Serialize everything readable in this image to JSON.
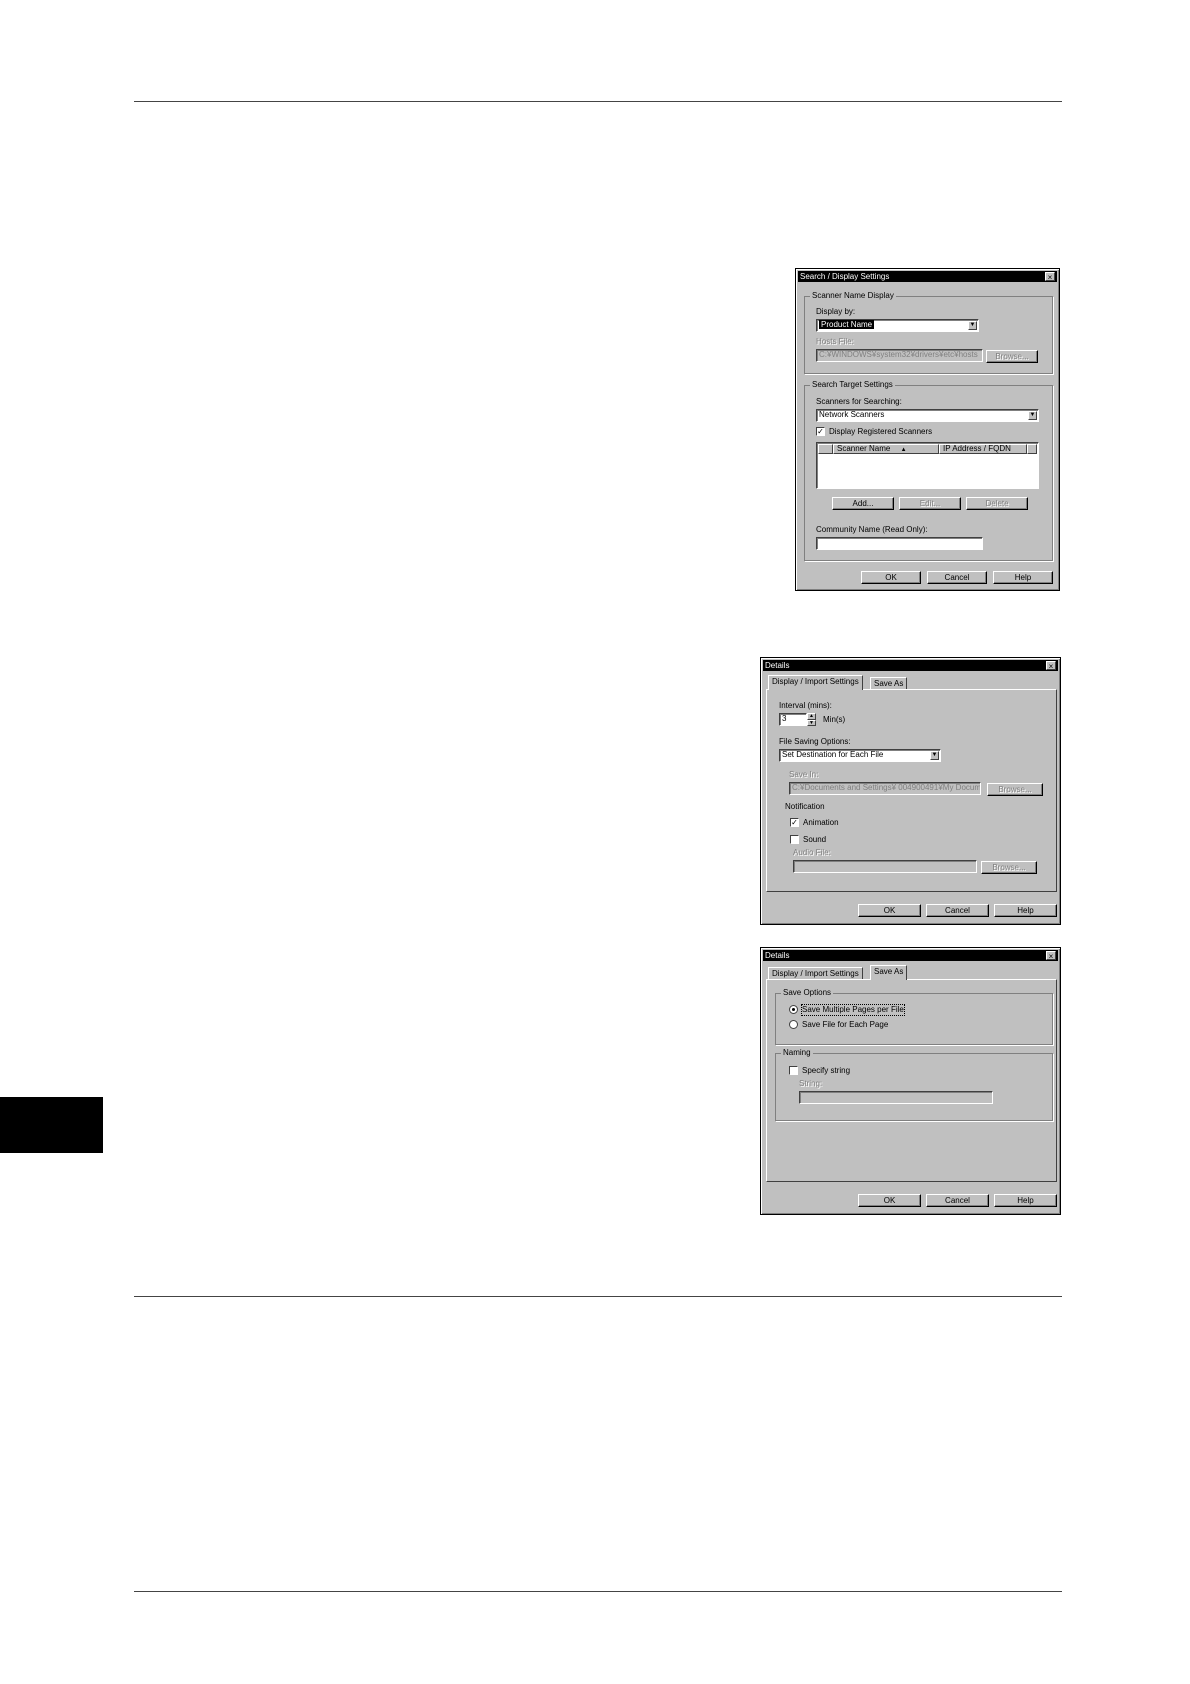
{
  "dlg1": {
    "title": "Search / Display Settings",
    "close_glyph": "×",
    "group_scanner_name": "Scanner Name Display",
    "display_by_label": "Display by:",
    "display_by_value": "Product Name",
    "hosts_file_label": "Hosts File:",
    "hosts_file_value": "C:¥WINDOWS¥system32¥drivers¥etc¥hosts",
    "browse_label": "Browse...",
    "group_search_target": "Search Target Settings",
    "scanners_label": "Scanners for Searching:",
    "scanners_value": "Network Scanners",
    "display_registered_label": "Display Registered Scanners",
    "col_scanner_name": "Scanner Name",
    "col_ip": "IP Address / FQDN",
    "add_label": "Add...",
    "edit_label": "Edit...",
    "delete_label": "Delete",
    "community_label": "Community Name (Read Only):",
    "ok_label": "OK",
    "cancel_label": "Cancel",
    "help_label": "Help"
  },
  "dlg2": {
    "title": "Details",
    "close_glyph": "×",
    "tab1": "Display / Import Settings",
    "tab2": "Save As",
    "interval_label": "Interval (mins):",
    "interval_value": "3",
    "interval_unit": "Min(s)",
    "file_saving_label": "File Saving Options:",
    "file_saving_value": "Set Destination for Each File",
    "save_in_label": "Save In:",
    "save_in_value": "C:¥Documents and Settings¥ 004900491¥My Documer",
    "browse_label": "Browse...",
    "notification_label": "Notification",
    "animation_label": "Animation",
    "sound_label": "Sound",
    "audio_file_label": "Audio File:",
    "ok_label": "OK",
    "cancel_label": "Cancel",
    "help_label": "Help"
  },
  "dlg3": {
    "title": "Details",
    "close_glyph": "×",
    "tab1": "Display / Import Settings",
    "tab2": "Save As",
    "group_save_options": "Save Options",
    "radio1_label": "Save Multiple Pages per File",
    "radio2_label": "Save File for Each Page",
    "group_naming": "Naming",
    "specify_label": "Specify string",
    "string_label": "String:",
    "ok_label": "OK",
    "cancel_label": "Cancel",
    "help_label": "Help"
  }
}
